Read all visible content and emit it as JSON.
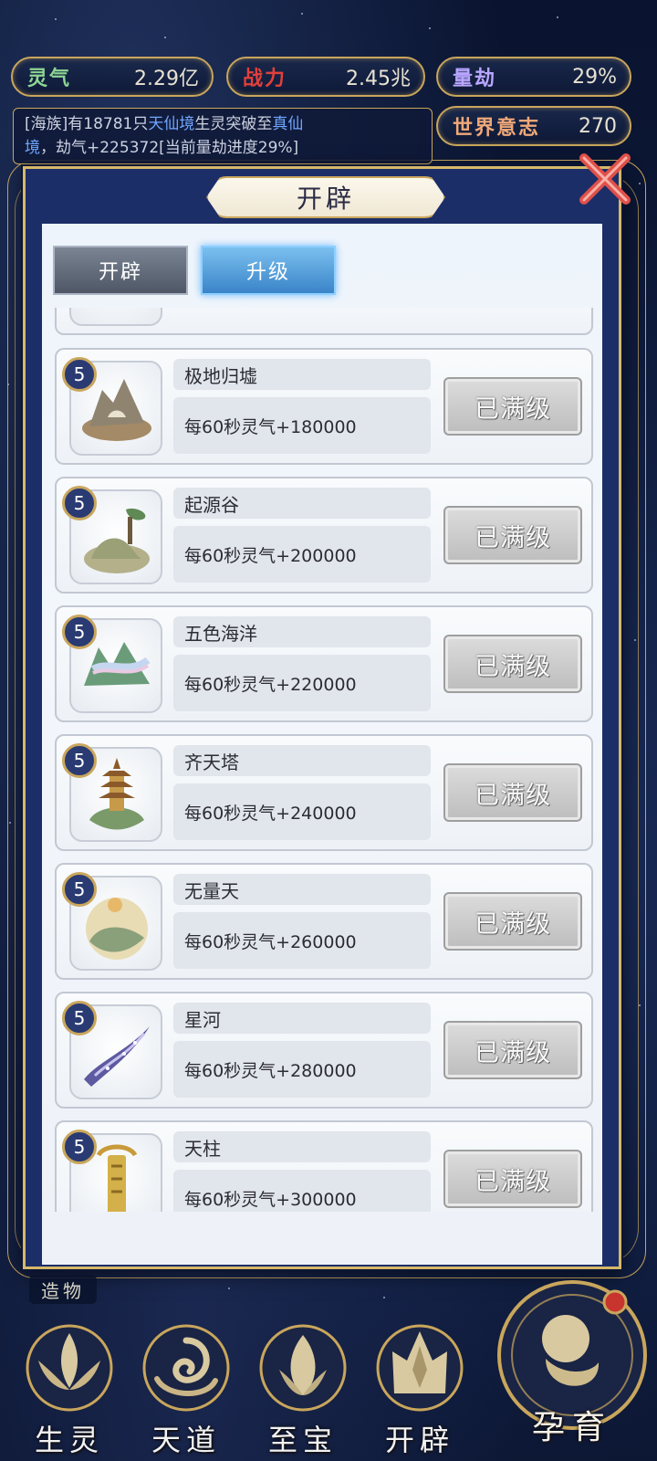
{
  "resources": {
    "lingqi": {
      "label": "灵气",
      "value": "2.29亿"
    },
    "zhanli": {
      "label": "战力",
      "value": "2.45兆"
    },
    "liangjie": {
      "label": "量劫",
      "value": "29%"
    },
    "shijie": {
      "label": "世界意志",
      "value": "270"
    }
  },
  "news": {
    "prefix": "[海族]有18781只",
    "realm1": "天仙境",
    "mid": "生灵突破至",
    "realm2": "真仙",
    "line2_realm2": "境",
    "suffix": "，劫气+225372[当前量劫进度29%]"
  },
  "modal": {
    "title": "开辟",
    "tabs": [
      {
        "label": "开辟",
        "active": false
      },
      {
        "label": "升级",
        "active": true
      }
    ],
    "items": [
      {
        "level": "5",
        "name": "极地归墟",
        "desc": "每60秒灵气+180000",
        "button": "已满级",
        "icon": "floating-rock-icon"
      },
      {
        "level": "5",
        "name": "起源谷",
        "desc": "每60秒灵气+200000",
        "button": "已满级",
        "icon": "pine-valley-icon"
      },
      {
        "level": "5",
        "name": "五色海洋",
        "desc": "每60秒灵气+220000",
        "button": "已满级",
        "icon": "rainbow-sea-icon"
      },
      {
        "level": "5",
        "name": "齐天塔",
        "desc": "每60秒灵气+240000",
        "button": "已满级",
        "icon": "pagoda-icon"
      },
      {
        "level": "5",
        "name": "无量天",
        "desc": "每60秒灵气+260000",
        "button": "已满级",
        "icon": "cloud-sky-icon"
      },
      {
        "level": "5",
        "name": "星河",
        "desc": "每60秒灵气+280000",
        "button": "已满级",
        "icon": "galaxy-icon"
      },
      {
        "level": "5",
        "name": "天柱",
        "desc": "每60秒灵气+300000",
        "button": "已满级",
        "icon": "pillar-icon"
      }
    ]
  },
  "nav": {
    "zaowu": "造物",
    "items": [
      {
        "label": "生灵",
        "icon": "lotus-icon"
      },
      {
        "label": "天道",
        "icon": "swirl-icon"
      },
      {
        "label": "至宝",
        "icon": "treasure-icon"
      },
      {
        "label": "开辟",
        "icon": "mountain-icon"
      }
    ],
    "yunyu": "孕育"
  },
  "colors": {
    "gold": "#c9a65c",
    "modal_bg": "#1c2e68",
    "tab_active": "#3a84c8",
    "max_button": "#bdbdbd"
  }
}
